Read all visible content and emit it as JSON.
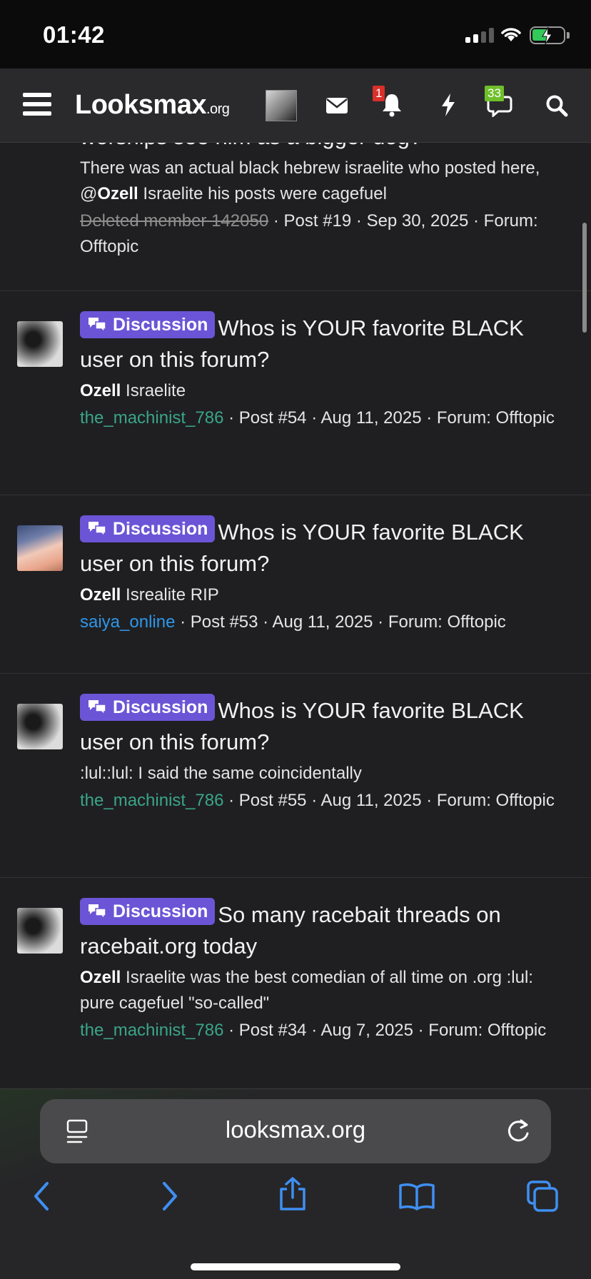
{
  "status": {
    "time": "01:42"
  },
  "header": {
    "logo_main": "Looksmax",
    "logo_suffix": ".org",
    "alerts_count": "1",
    "chats_count": "33"
  },
  "posts": [
    {
      "title_partial": "worships see him as a bigger dog?",
      "snippet_text_1": "There was an actual black hebrew israelite who posted here, @",
      "snippet_bold": "Ozell",
      "snippet_text_2": " Israelite his posts were cagefuel",
      "user": "Deleted member 142050",
      "meta": " · Post #19 · Sep 30, 2025 · Forum: Offtopic"
    },
    {
      "badge": "Discussion",
      "title": "Whos is YOUR favorite BLACK user on this forum?",
      "snippet_bold": "Ozell",
      "snippet_text": " Israelite",
      "user": "the_machinist_786",
      "meta": " · Post #54 · Aug 11, 2025 · Forum: Offtopic"
    },
    {
      "badge": "Discussion",
      "title": "Whos is YOUR favorite BLACK user on this forum?",
      "snippet_bold": "Ozell",
      "snippet_text": " Isrealite RIP",
      "user": "saiya_online",
      "meta": " · Post #53 · Aug 11, 2025 · Forum: Offtopic"
    },
    {
      "badge": "Discussion",
      "title": "Whos is YOUR favorite BLACK user on this forum?",
      "snippet_text": ":lul::lul: I said the same coincidentally",
      "user": "the_machinist_786",
      "meta": " · Post #55 · Aug 11, 2025 · Forum: Offtopic"
    },
    {
      "badge": "Discussion",
      "title": "So many racebait threads on racebait.org today",
      "snippet_bold": "Ozell",
      "snippet_text": " Israelite was the best comedian of all time on .org :lul: pure cagefuel \"so-called\"",
      "user": "the_machinist_786",
      "meta": " · Post #34 · Aug 7, 2025 · Forum: Offtopic"
    }
  ],
  "browser": {
    "url": "looksmax.org"
  },
  "colors": {
    "badge_bg": "#6b55d6",
    "user_green": "#3aa587",
    "user_blue": "#2f96e8"
  }
}
